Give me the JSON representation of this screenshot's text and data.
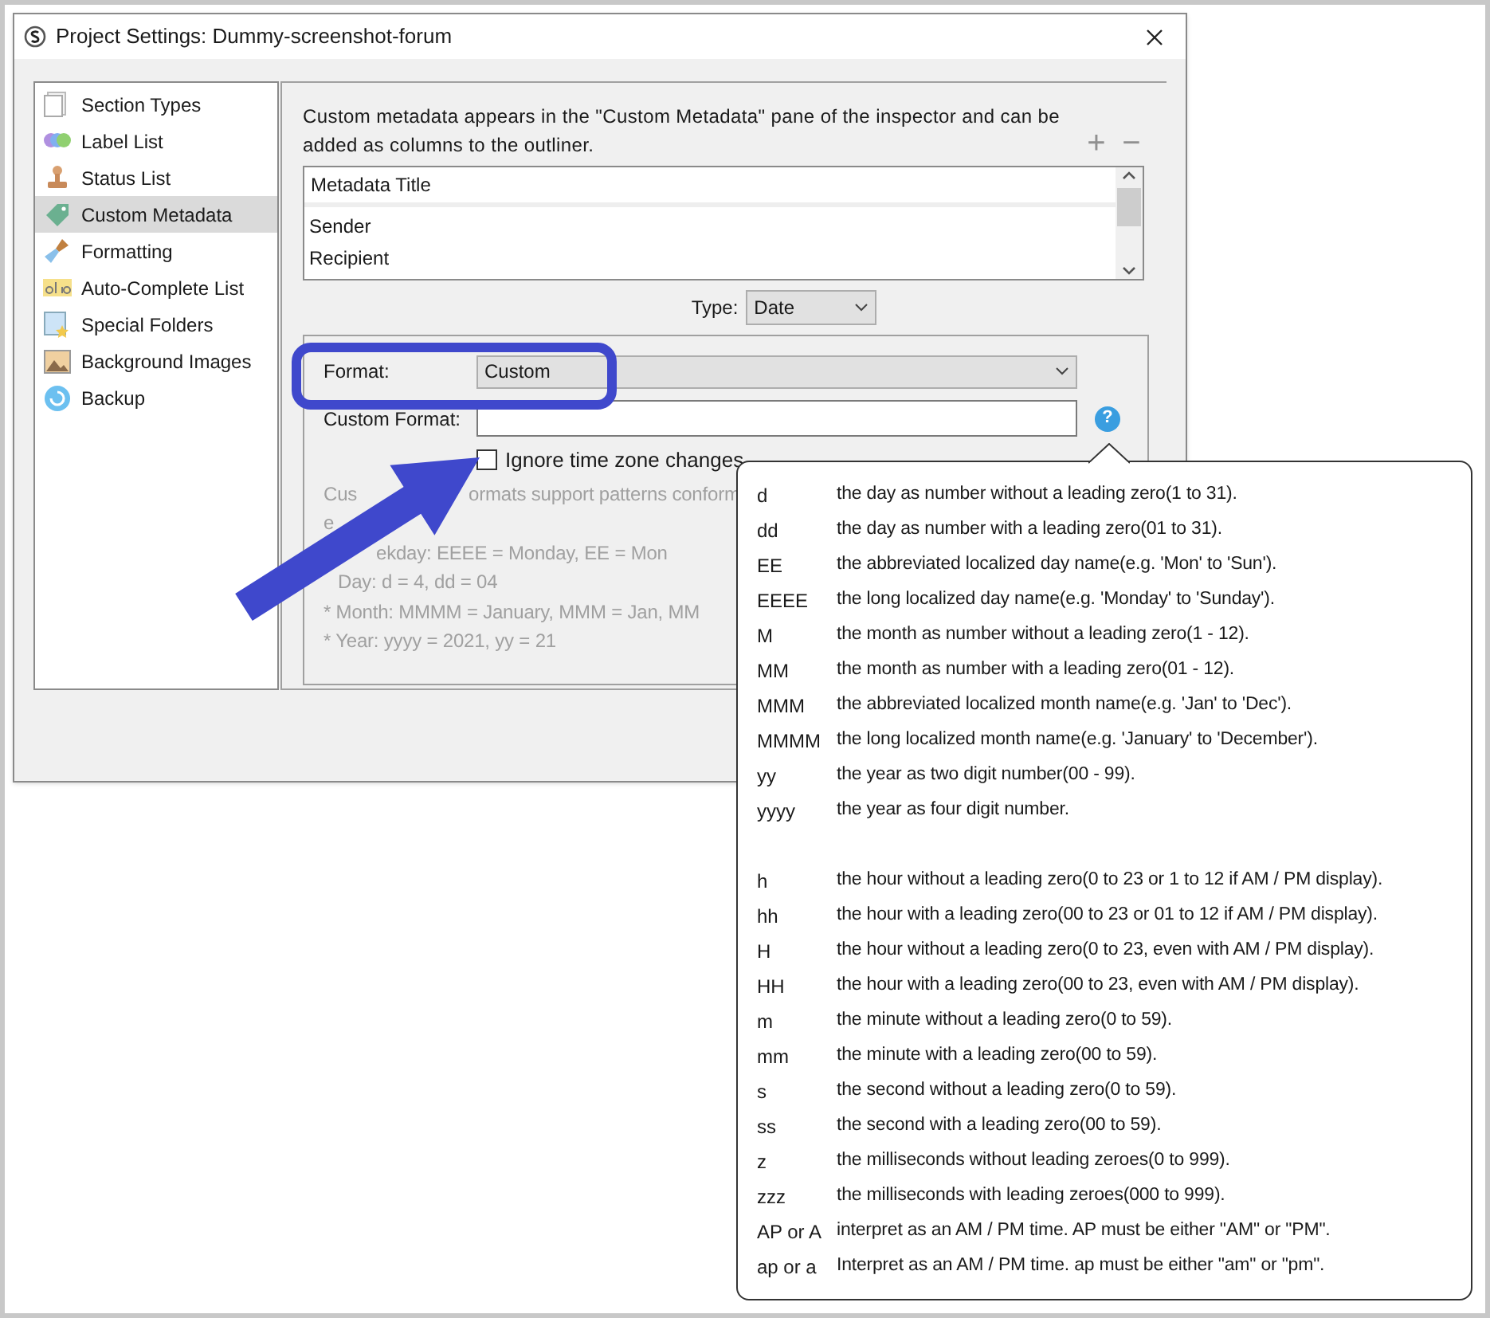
{
  "window": {
    "title": "Project Settings: Dummy-screenshot-forum"
  },
  "sidebar": {
    "items": [
      {
        "label": "Section Types",
        "selected": false
      },
      {
        "label": "Label List",
        "selected": false
      },
      {
        "label": "Status List",
        "selected": false
      },
      {
        "label": "Custom Metadata",
        "selected": true
      },
      {
        "label": "Formatting",
        "selected": false
      },
      {
        "label": "Auto-Complete List",
        "selected": false
      },
      {
        "label": "Special Folders",
        "selected": false
      },
      {
        "label": "Background Images",
        "selected": false
      },
      {
        "label": "Backup",
        "selected": false
      }
    ]
  },
  "description": "Custom metadata appears in the \"Custom Metadata\" pane of the inspector and can be added as columns to the outliner.",
  "add_button": "+",
  "remove_button": "−",
  "table": {
    "columns": [
      "Metadata Title"
    ],
    "rows": [
      "Sender",
      "Recipient"
    ]
  },
  "type_field": {
    "label": "Type:",
    "value": "Date"
  },
  "format_field": {
    "label": "Format:",
    "value": "Custom"
  },
  "custom_format_field": {
    "label": "Custom Format:"
  },
  "help_button": "?",
  "ignore_time_zone": {
    "label": "Ignore time zone changes",
    "checked": false
  },
  "help_lines": [
    [
      "Cus",
      "ormats support patterns conform"
    ],
    [
      "e"
    ],
    [
      "ekday: EEEE = Monday, EE = Mon"
    ],
    [
      "Day: d = 4, dd = 04"
    ],
    [
      "* Month: MMMM = January, MMM = Jan, MM"
    ],
    [
      "* Year: yyyy = 2021, yy = 21"
    ]
  ],
  "tooltip": {
    "groups": [
      [
        {
          "pattern": "d",
          "description": "the day as number without a leading zero(1 to 31)."
        },
        {
          "pattern": "dd",
          "description": "the day as number with a leading zero(01 to 31)."
        },
        {
          "pattern": "EE",
          "description": "the abbreviated localized day name(e.g. 'Mon' to 'Sun')."
        },
        {
          "pattern": "EEEE",
          "description": "the long localized day name(e.g. 'Monday' to 'Sunday')."
        },
        {
          "pattern": "M",
          "description": "the month as number without a leading zero(1 - 12)."
        },
        {
          "pattern": "MM",
          "description": "the month as number with a leading zero(01 - 12)."
        },
        {
          "pattern": "MMM",
          "description": "the abbreviated localized month name(e.g. 'Jan' to 'Dec')."
        },
        {
          "pattern": "MMMM",
          "description": "the long localized month name(e.g. 'January' to 'December')."
        },
        {
          "pattern": "yy",
          "description": "the year as two digit number(00 - 99)."
        },
        {
          "pattern": "yyyy",
          "description": "the year as four digit number."
        }
      ],
      [
        {
          "pattern": "h",
          "description": "the hour without a leading zero(0 to 23 or 1 to 12 if AM / PM display)."
        },
        {
          "pattern": "hh",
          "description": "the hour with a leading zero(00 to 23 or 01 to 12 if AM / PM display)."
        },
        {
          "pattern": "H",
          "description": "the hour without a leading zero(0 to 23, even with AM / PM display)."
        },
        {
          "pattern": "HH",
          "description": "the hour with a leading zero(00 to 23, even with AM / PM display)."
        },
        {
          "pattern": "m",
          "description": "the minute without a leading zero(0 to 59)."
        },
        {
          "pattern": "mm",
          "description": "the minute with a leading zero(00 to 59)."
        },
        {
          "pattern": "s",
          "description": "the second without a leading zero(0 to 59)."
        },
        {
          "pattern": "ss",
          "description": "the second with a leading zero(00 to 59)."
        },
        {
          "pattern": "z",
          "description": "the milliseconds without leading zeroes(0 to 999)."
        },
        {
          "pattern": "zzz",
          "description": "the milliseconds with leading zeroes(000 to 999)."
        },
        {
          "pattern": "AP or A",
          "description": "interpret as an AM / PM time. AP must be either \"AM\" or \"PM\"."
        },
        {
          "pattern": "ap or a",
          "description": "Interpret as an AM / PM time. ap must be either \"am\" or \"pm\"."
        }
      ]
    ]
  }
}
